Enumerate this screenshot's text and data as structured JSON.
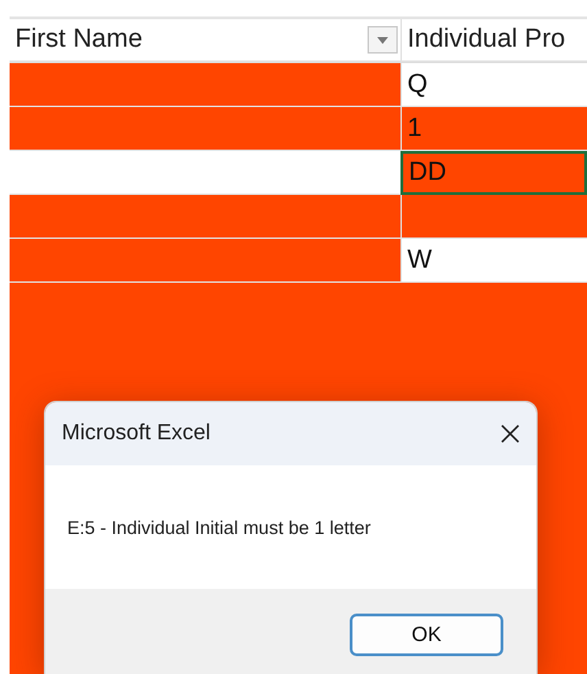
{
  "sheet": {
    "columns": [
      {
        "label": "First Name",
        "filter": true
      },
      {
        "label": "Individual Pro",
        "filter": false
      }
    ],
    "rows": [
      {
        "cells": [
          {
            "color": "#ff4500",
            "selected": false
          },
          {
            "text": "Q",
            "color": "#ffffff",
            "selected": false
          }
        ]
      },
      {
        "cells": [
          {
            "color": "#ff4500",
            "selected": false
          },
          {
            "text": "1",
            "color": "#ff4500",
            "selected": false
          }
        ]
      },
      {
        "cells": [
          {
            "color": "#ffffff",
            "selected": false
          },
          {
            "text": "DD",
            "color": "#ff4500",
            "selected": true
          }
        ]
      },
      {
        "cells": [
          {
            "color": "#ff4500",
            "selected": false
          },
          {
            "color": "#ff4500",
            "selected": false
          }
        ]
      },
      {
        "cells": [
          {
            "color": "#ff4500",
            "selected": false
          },
          {
            "text": "W",
            "color": "#ffffff",
            "selected": false
          }
        ]
      }
    ]
  },
  "dialog": {
    "title": "Microsoft Excel",
    "message": "E:5 - Individual Initial must be 1 letter",
    "buttons": [
      "OK"
    ]
  }
}
